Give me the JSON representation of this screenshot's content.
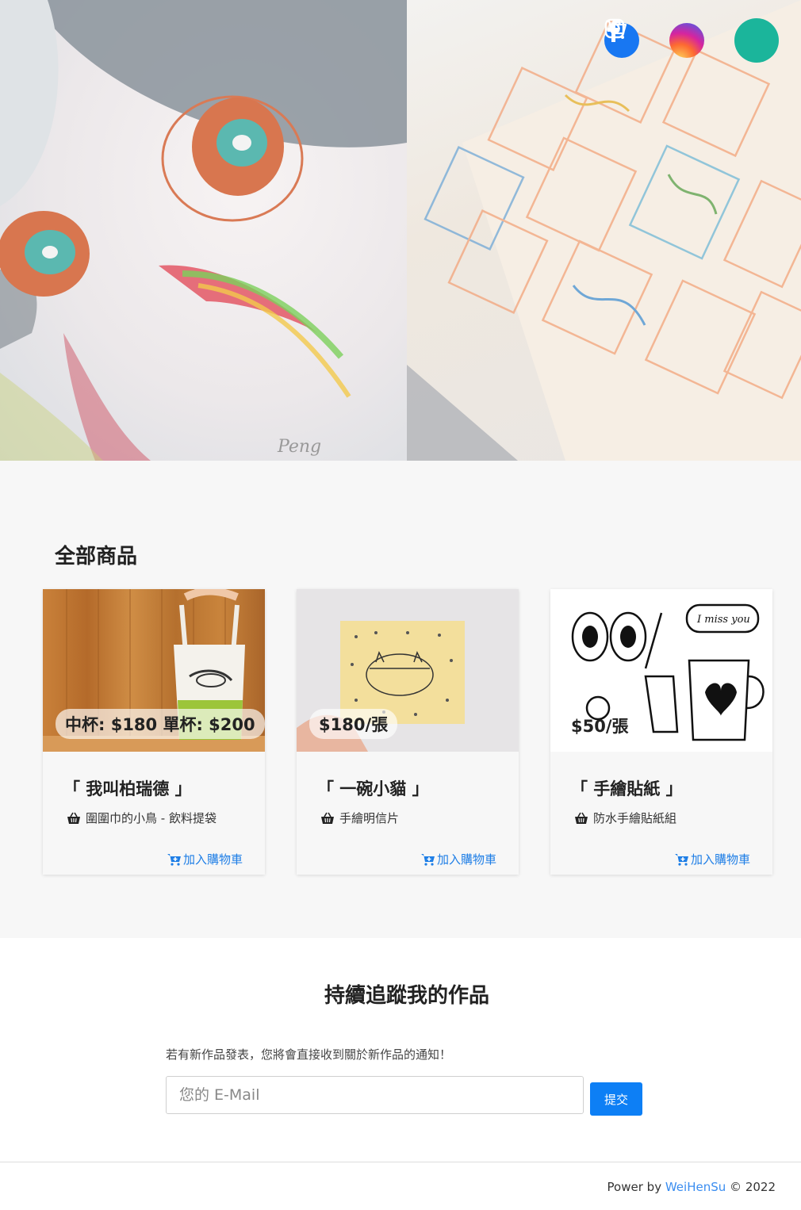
{
  "hero": {
    "social": {
      "facebook_icon": "facebook-icon",
      "instagram_icon": "instagram-icon",
      "cart_icon": "shopping-cart-icon"
    }
  },
  "products": {
    "title": "全部商品",
    "items": [
      {
        "price": "中杯: $180 單杯: $200",
        "title": "「 我叫柏瑞德 」",
        "subtitle": "圍圍巾的小鳥 - 飲料提袋",
        "add_to_cart": "加入購物車"
      },
      {
        "price": "$180/張",
        "title": "「 一碗小貓 」",
        "subtitle": "手繪明信片",
        "add_to_cart": "加入購物車"
      },
      {
        "price": "$50/張",
        "title": "「 手繪貼紙 」",
        "subtitle": "防水手繪貼紙組",
        "add_to_cart": "加入購物車"
      }
    ]
  },
  "subscribe": {
    "title": "持續追蹤我的作品",
    "description": "若有新作品發表，您將會直接收到關於新作品的通知！",
    "email_placeholder": "您的 E-Mail",
    "submit_label": "提交"
  },
  "footer": {
    "prefix": "Power by",
    "author": "WeiHenSu",
    "suffix": "© 2022"
  },
  "colors": {
    "accent": "#1bb59b",
    "link": "#1e7ee6",
    "button": "#0d7ff5",
    "facebook": "#1877f2"
  }
}
